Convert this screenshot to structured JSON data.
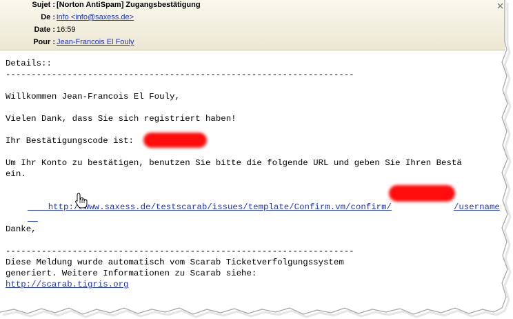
{
  "header": {
    "subject_label": "Sujet :",
    "subject_value": "[Norton AntiSpam] Zugangsbestätigung",
    "from_label": "De :",
    "from_value": "info <info@saxess.de>",
    "date_label": "Date :",
    "date_value": "16:59",
    "to_label": "Pour :",
    "to_value": "Jean-Francois El Fouly"
  },
  "body": {
    "details": "Details::",
    "separator": "--------------------------------------------------------------------",
    "greeting": "Willkommen Jean-Francois El Fouly,",
    "thanks_registered": "Vielen Dank, dass Sie sich registriert haben!",
    "code_label": "Ihr Bestätigungscode ist:",
    "instructions_line1": "Um Ihr Konto zu bestätigen, benutzen Sie bitte die folgende URL und geben Sie Ihren Bestä",
    "instructions_line2": "ein.",
    "confirm_url": "http://www.saxess.de/testscarab/issues/template/Confirm.vm/confirm/",
    "confirm_url_tail": "/username",
    "danke": "Danke,",
    "separator2": "--------------------------------------------------------------------",
    "footer_line1": "Diese Meldung wurde automatisch vom Scarab Ticketverfolgungssystem",
    "footer_line2": "generiert. Weitere Informationen zu Scarab siehe:",
    "footer_link": "http://scarab.tigris.org"
  },
  "colors": {
    "link": "#1a35c8",
    "header_bg": "#ece7d2",
    "redaction": "#ff0000"
  },
  "icons": {
    "cursor": "hand-pointer-icon",
    "corner": "close-icon"
  }
}
